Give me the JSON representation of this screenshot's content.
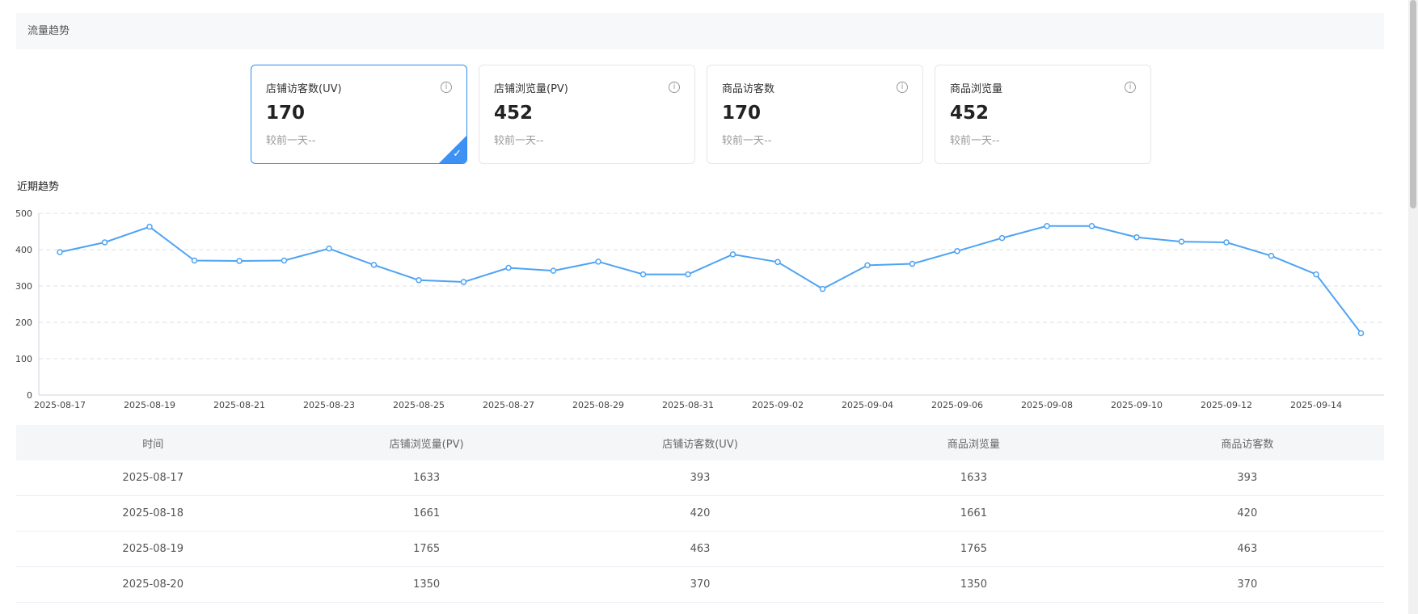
{
  "section": {
    "title": "流量趋势"
  },
  "cards": [
    {
      "title": "店铺访客数(UV)",
      "value": "170",
      "compare": "较前一天--",
      "info_icon": "info-circle-icon",
      "selected": true
    },
    {
      "title": "店铺浏览量(PV)",
      "value": "452",
      "compare": "较前一天--",
      "info_icon": "info-circle-icon",
      "selected": false
    },
    {
      "title": "商品访客数",
      "value": "170",
      "compare": "较前一天--",
      "info_icon": "info-circle-icon",
      "selected": false
    },
    {
      "title": "商品浏览量",
      "value": "452",
      "compare": "较前一天--",
      "info_icon": "info-circle-icon",
      "selected": false
    }
  ],
  "trend": {
    "title": "近期趋势"
  },
  "colors": {
    "accent": "#3d91f5",
    "line": "#4ea3f3",
    "grid": "#dcdfe6"
  },
  "chart_data": {
    "type": "line",
    "x": [
      "2025-08-17",
      "2025-08-18",
      "2025-08-19",
      "2025-08-20",
      "2025-08-21",
      "2025-08-22",
      "2025-08-23",
      "2025-08-24",
      "2025-08-25",
      "2025-08-26",
      "2025-08-27",
      "2025-08-28",
      "2025-08-29",
      "2025-08-30",
      "2025-08-31",
      "2025-09-01",
      "2025-09-02",
      "2025-09-03",
      "2025-09-04",
      "2025-09-05",
      "2025-09-06",
      "2025-09-07",
      "2025-09-08",
      "2025-09-09",
      "2025-09-10",
      "2025-09-11",
      "2025-09-12",
      "2025-09-13",
      "2025-09-14",
      "2025-09-15"
    ],
    "x_tick_labels": [
      "2025-08-17",
      "2025-08-19",
      "2025-08-21",
      "2025-08-23",
      "2025-08-25",
      "2025-08-27",
      "2025-08-29",
      "2025-08-31",
      "2025-09-02",
      "2025-09-04",
      "2025-09-06",
      "2025-09-08",
      "2025-09-10",
      "2025-09-12",
      "2025-09-14"
    ],
    "series": [
      {
        "values": [
          393,
          420,
          463,
          370,
          369,
          370,
          403,
          358,
          316,
          311,
          350,
          342,
          367,
          332,
          332,
          387,
          366,
          292,
          357,
          361,
          396,
          432,
          465,
          465,
          434,
          422,
          420,
          383,
          332,
          170
        ]
      }
    ],
    "ylim": [
      0,
      500
    ],
    "y_ticks": [
      0,
      100,
      200,
      300,
      400,
      500
    ],
    "grid": true,
    "legend": "none",
    "xlabel": "",
    "ylabel": ""
  },
  "table": {
    "headers": [
      "时间",
      "店铺浏览量(PV)",
      "店铺访客数(UV)",
      "商品浏览量",
      "商品访客数"
    ],
    "rows": [
      [
        "2025-08-17",
        "1633",
        "393",
        "1633",
        "393"
      ],
      [
        "2025-08-18",
        "1661",
        "420",
        "1661",
        "420"
      ],
      [
        "2025-08-19",
        "1765",
        "463",
        "1765",
        "463"
      ],
      [
        "2025-08-20",
        "1350",
        "370",
        "1350",
        "370"
      ]
    ]
  }
}
